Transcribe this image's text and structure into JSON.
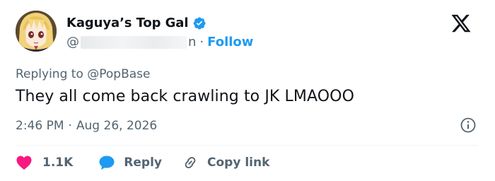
{
  "author": {
    "display_name": "Kaguya’s Top Gal",
    "handle_prefix": "@",
    "handle_suffix": "n",
    "separator": "·",
    "follow_label": "Follow",
    "avatar_icon": "anime-avatar",
    "verified_icon": "verified-badge-icon",
    "verified_color": "#1d9bf0"
  },
  "brand": {
    "logo_icon": "x-logo-icon"
  },
  "tweet": {
    "replying_to": "Replying to @PopBase",
    "text": "They all come back crawling to JK LMAOOO",
    "time": "2:46 PM",
    "separator": "·",
    "date": "Aug 26, 2026"
  },
  "actions": {
    "like_count": "1.1K",
    "reply_label": "Reply",
    "copy_label": "Copy link"
  },
  "colors": {
    "text_primary": "#0f1419",
    "text_secondary": "#536471",
    "accent": "#1d9bf0",
    "like": "#f91880"
  }
}
